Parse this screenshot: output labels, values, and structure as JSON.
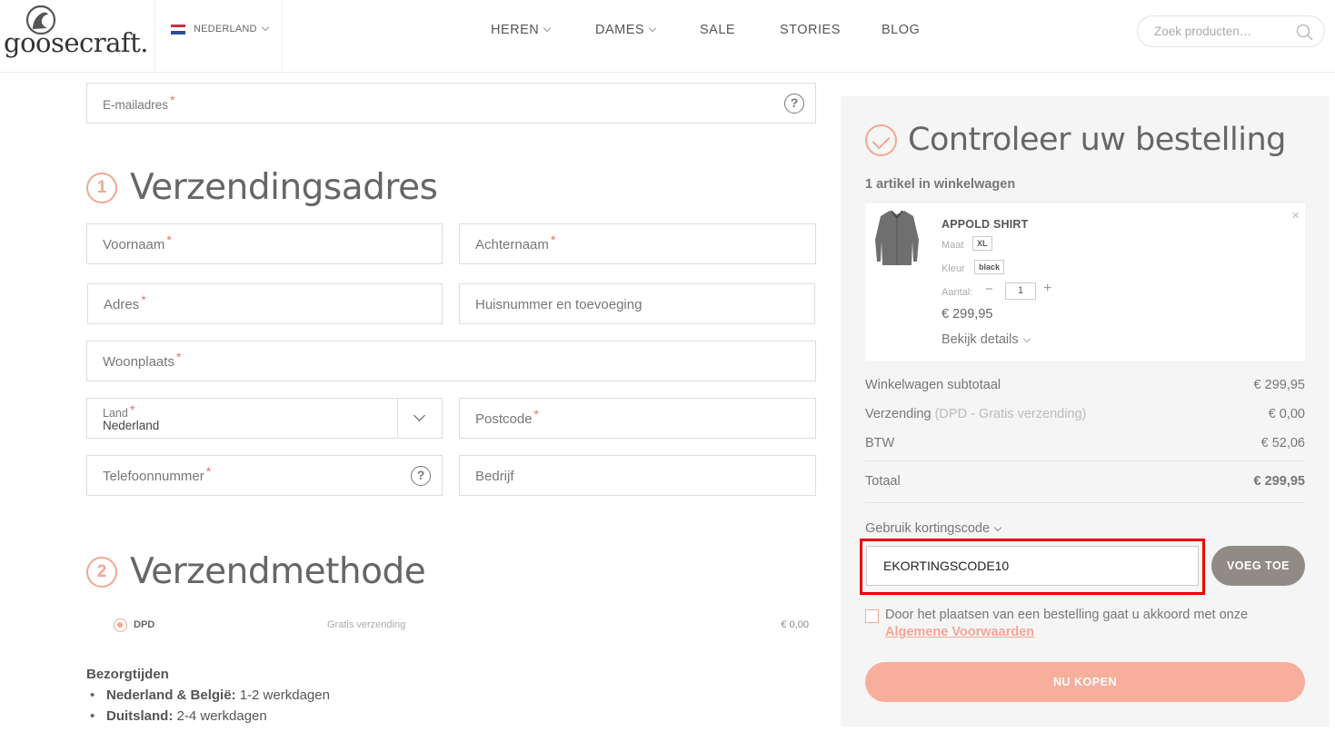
{
  "header": {
    "logo_text": "goosecraft.",
    "country": "NEDERLAND",
    "nav": [
      {
        "label": "HEREN",
        "has_dropdown": true
      },
      {
        "label": "DAMES",
        "has_dropdown": true
      },
      {
        "label": "SALE",
        "has_dropdown": false
      },
      {
        "label": "STORIES",
        "has_dropdown": false
      },
      {
        "label": "BLOG",
        "has_dropdown": false
      }
    ],
    "search_placeholder": "Zoek producten…"
  },
  "form": {
    "email_label": "E-mailadres",
    "section1": {
      "number": "1",
      "title": "Verzendingsadres"
    },
    "fields": {
      "first_name": "Voornaam",
      "last_name": "Achternaam",
      "address": "Adres",
      "house_number": "Huisnummer en toevoeging",
      "city": "Woonplaats",
      "country_label": "Land",
      "country_value": "Nederland",
      "postcode": "Postcode",
      "phone": "Telefoonnummer",
      "company": "Bedrijf"
    },
    "required_mark": "*",
    "section2": {
      "number": "2",
      "title": "Verzendmethode"
    },
    "shipping": {
      "method": "DPD",
      "desc": "Gratis verzending",
      "price": "€ 0,00"
    },
    "delivery": {
      "title": "Bezorgtijden",
      "items": [
        {
          "region": "Nederland & België:",
          "time": "1-2 werkdagen"
        },
        {
          "region": "Duitsland:",
          "time": "2-4 werkdagen"
        }
      ]
    }
  },
  "order": {
    "title": "Controleer uw bestelling",
    "cart_count": "1 artikel in winkelwagen",
    "item": {
      "name": "APPOLD SHIRT",
      "size_label": "Maat",
      "size": "XL",
      "color_label": "Kleur",
      "color": "black",
      "qty_label": "Aantal:",
      "qty": "1",
      "minus": "−",
      "plus": "+",
      "price": "€ 299,95",
      "details": "Bekijk details",
      "remove": "×"
    },
    "subtotal_label": "Winkelwagen subtotaal",
    "subtotal": "€ 299,95",
    "shipping_label": "Verzending",
    "shipping_note": "(DPD - Gratis verzending)",
    "shipping": "€ 0,00",
    "tax_label": "BTW",
    "tax": "€ 52,06",
    "total_label": "Totaal",
    "total": "€ 299,95",
    "coupon_toggle": "Gebruik kortingscode",
    "coupon_value": "EKORTINGSCODE10",
    "coupon_button": "VOEG TOE",
    "terms_text": "Door het plaatsen van een bestelling gaat u akkoord met onze",
    "terms_link": "Algemene Voorwaarden",
    "buy_button": "NU KOPEN"
  },
  "colors": {
    "accent": "#f4a693",
    "buy_button": "#f8ae9c",
    "coupon_button": "#918b86",
    "highlight_box": "#ee0000"
  }
}
